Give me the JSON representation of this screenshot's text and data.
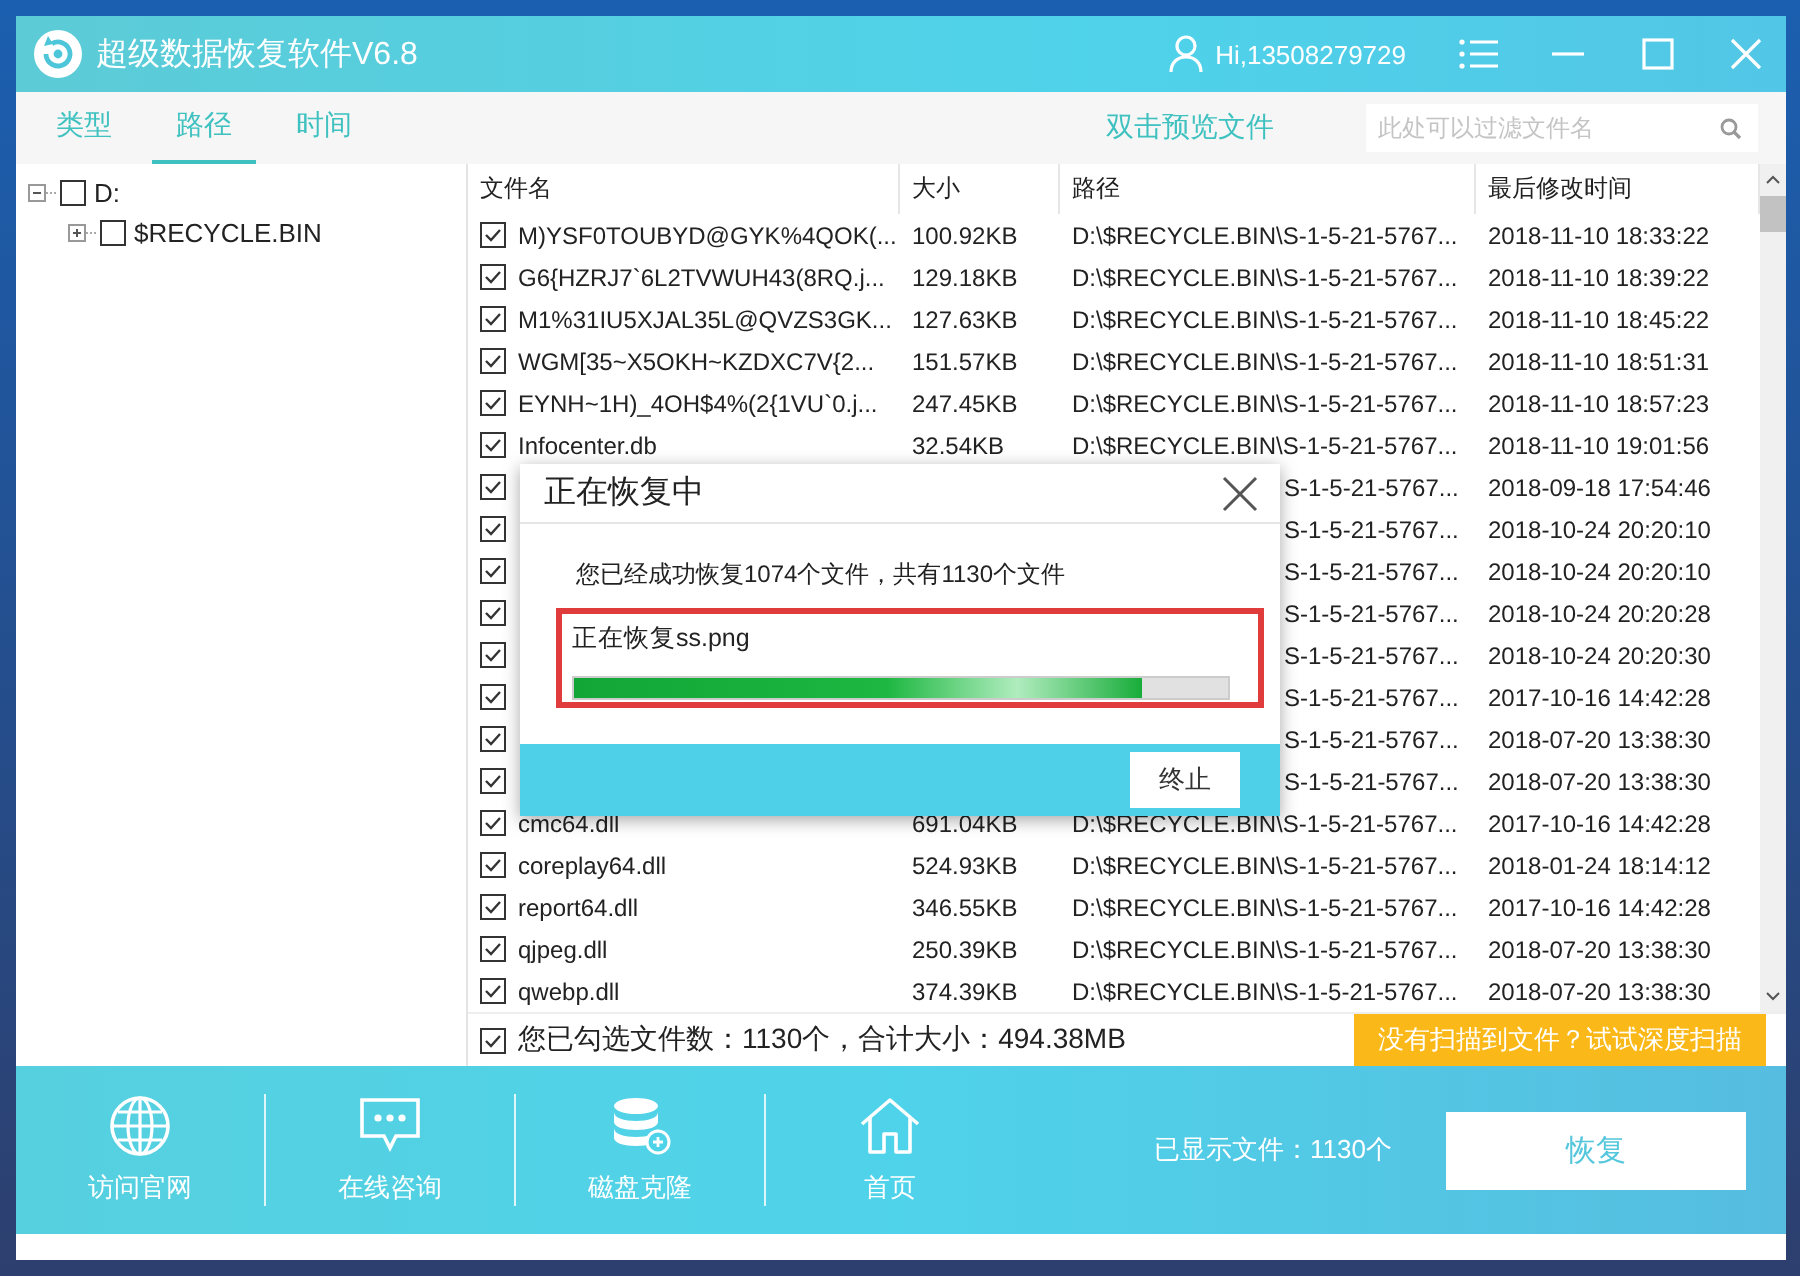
{
  "window": {
    "title": "超级数据恢复软件V6.8",
    "user": "Hi,13508279729"
  },
  "tabs": [
    {
      "label": "类型",
      "selected": false
    },
    {
      "label": "路径",
      "selected": true
    },
    {
      "label": "时间",
      "selected": false
    }
  ],
  "preview_link": "双击预览文件",
  "search": {
    "placeholder": "此处可以过滤文件名"
  },
  "tree": [
    {
      "label": "D:",
      "checked": false,
      "expanded": true,
      "children": [
        {
          "label": "$RECYCLE.BIN",
          "checked": false,
          "expanded": false
        }
      ]
    }
  ],
  "table": {
    "columns": [
      "文件名",
      "大小",
      "路径",
      "最后修改时间"
    ],
    "rows": [
      {
        "kind": "full",
        "checked": true,
        "name": "M)YSF0TOUBYD@GYK%4QOK(...",
        "size": "100.92KB",
        "path": "D:\\$RECYCLE.BIN\\S-1-5-21-5767...",
        "modified": "2018-11-10 18:33:22"
      },
      {
        "kind": "full",
        "checked": true,
        "name": "G6{HZRJ7`6L2TVWUH43(8RQ.j...",
        "size": "129.18KB",
        "path": "D:\\$RECYCLE.BIN\\S-1-5-21-5767...",
        "modified": "2018-11-10 18:39:22"
      },
      {
        "kind": "full",
        "checked": true,
        "name": "M1%31IU5XJAL35L@QVZS3GK...",
        "size": "127.63KB",
        "path": "D:\\$RECYCLE.BIN\\S-1-5-21-5767...",
        "modified": "2018-11-10 18:45:22"
      },
      {
        "kind": "full",
        "checked": true,
        "name": "WGM[35~X5OKH~KZDXC7V{2...",
        "size": "151.57KB",
        "path": "D:\\$RECYCLE.BIN\\S-1-5-21-5767...",
        "modified": "2018-11-10 18:51:31"
      },
      {
        "kind": "full",
        "checked": true,
        "name": "EYNH~1H)_4OH$4%(2{1VU`0.j...",
        "size": "247.45KB",
        "path": "D:\\$RECYCLE.BIN\\S-1-5-21-5767...",
        "modified": "2018-11-10 18:57:23"
      },
      {
        "kind": "full",
        "checked": true,
        "name": "Infocenter.db",
        "size": "32.54KB",
        "path": "D:\\$RECYCLE.BIN\\S-1-5-21-5767...",
        "modified": "2018-11-10 19:01:56"
      },
      {
        "kind": "covered",
        "checked": true,
        "path": "S-1-5-21-5767...",
        "modified": "2018-09-18 17:54:46"
      },
      {
        "kind": "covered",
        "checked": true,
        "path": "S-1-5-21-5767...",
        "modified": "2018-10-24 20:20:10"
      },
      {
        "kind": "covered",
        "checked": true,
        "path": "S-1-5-21-5767...",
        "modified": "2018-10-24 20:20:10"
      },
      {
        "kind": "covered",
        "checked": true,
        "path": "S-1-5-21-5767...",
        "modified": "2018-10-24 20:20:28"
      },
      {
        "kind": "covered",
        "checked": true,
        "path": "S-1-5-21-5767...",
        "modified": "2018-10-24 20:20:30"
      },
      {
        "kind": "covered",
        "checked": true,
        "path": "S-1-5-21-5767...",
        "modified": "2017-10-16 14:42:28"
      },
      {
        "kind": "covered",
        "checked": true,
        "path": "S-1-5-21-5767...",
        "modified": "2018-07-20 13:38:30"
      },
      {
        "kind": "covered",
        "checked": true,
        "path": "S-1-5-21-5767...",
        "modified": "2018-07-20 13:38:30"
      },
      {
        "kind": "full",
        "checked": true,
        "name": "cmc64.dll",
        "size": "691.04KB",
        "path": "D:\\$RECYCLE.BIN\\S-1-5-21-5767...",
        "modified": "2017-10-16 14:42:28"
      },
      {
        "kind": "full",
        "checked": true,
        "name": "coreplay64.dll",
        "size": "524.93KB",
        "path": "D:\\$RECYCLE.BIN\\S-1-5-21-5767...",
        "modified": "2018-01-24 18:14:12"
      },
      {
        "kind": "full",
        "checked": true,
        "name": "report64.dll",
        "size": "346.55KB",
        "path": "D:\\$RECYCLE.BIN\\S-1-5-21-5767...",
        "modified": "2017-10-16 14:42:28"
      },
      {
        "kind": "full",
        "checked": true,
        "name": "qjpeg.dll",
        "size": "250.39KB",
        "path": "D:\\$RECYCLE.BIN\\S-1-5-21-5767...",
        "modified": "2018-07-20 13:38:30"
      },
      {
        "kind": "full",
        "checked": true,
        "name": "qwebp.dll",
        "size": "374.39KB",
        "path": "D:\\$RECYCLE.BIN\\S-1-5-21-5767...",
        "modified": "2018-07-20 13:38:30"
      }
    ]
  },
  "selection": {
    "checked": true,
    "summary": "您已勾选文件数：1130个，合计大小：494.38MB",
    "deep_scan": "没有扫描到文件？试试深度扫描"
  },
  "dialog": {
    "title": "正在恢复中",
    "message": "您已经成功恢复1074个文件，共有1130个文件",
    "current": "正在恢复ss.png",
    "level": 0.87,
    "button": "终止"
  },
  "footer": {
    "nav": [
      {
        "kind": "globe",
        "label": "访问官网"
      },
      {
        "kind": "chat",
        "label": "在线咨询"
      },
      {
        "kind": "disk",
        "label": "磁盘克隆"
      },
      {
        "kind": "home",
        "label": "首页"
      }
    ],
    "shown": "已显示文件：1130个",
    "recover": "恢复"
  }
}
